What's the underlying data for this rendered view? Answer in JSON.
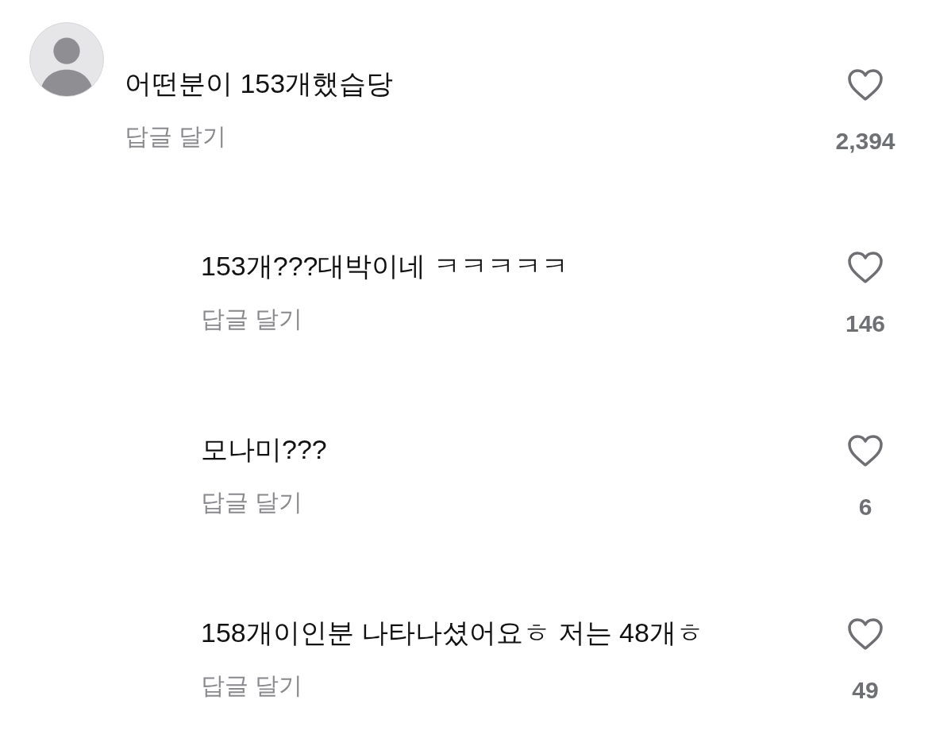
{
  "comments": [
    {
      "text": "어떤분이 153개했습당",
      "reply_label": "답글 달기",
      "likes": "2,394",
      "replies": [
        {
          "text": "153개???대박이네 ㅋㅋㅋㅋㅋ",
          "reply_label": "답글 달기",
          "likes": "146"
        },
        {
          "text": "모나미???",
          "reply_label": "답글 달기",
          "likes": "6"
        },
        {
          "text": "158개이인분 나타나셨어요ㅎ 저는 48개ㅎ",
          "reply_label": "답글 달기",
          "likes": "49"
        }
      ]
    }
  ]
}
